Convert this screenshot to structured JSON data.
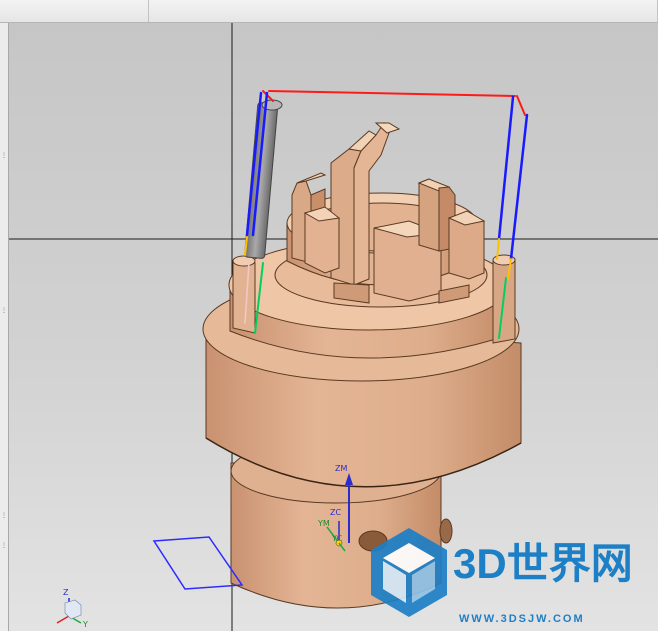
{
  "viewport": {
    "axes": {
      "zm": "ZM",
      "zc": "ZC",
      "ym": "YM",
      "yc": "YC"
    },
    "triad": {
      "z": "Z",
      "y": "Y"
    }
  },
  "watermark": {
    "title": "3D世界网",
    "url": "WWW.3DSJW.COM"
  },
  "colors": {
    "part": "#e3b594",
    "part_shade": "#c8946d",
    "toolpath_cut": "#1a1aff",
    "toolpath_rapid": "#ff1a1a",
    "toolpath_engage": "#ffc000",
    "toolpath_retract": "#00d060",
    "tool": "#8a8a8a",
    "watermark": "#1d7fc6"
  }
}
